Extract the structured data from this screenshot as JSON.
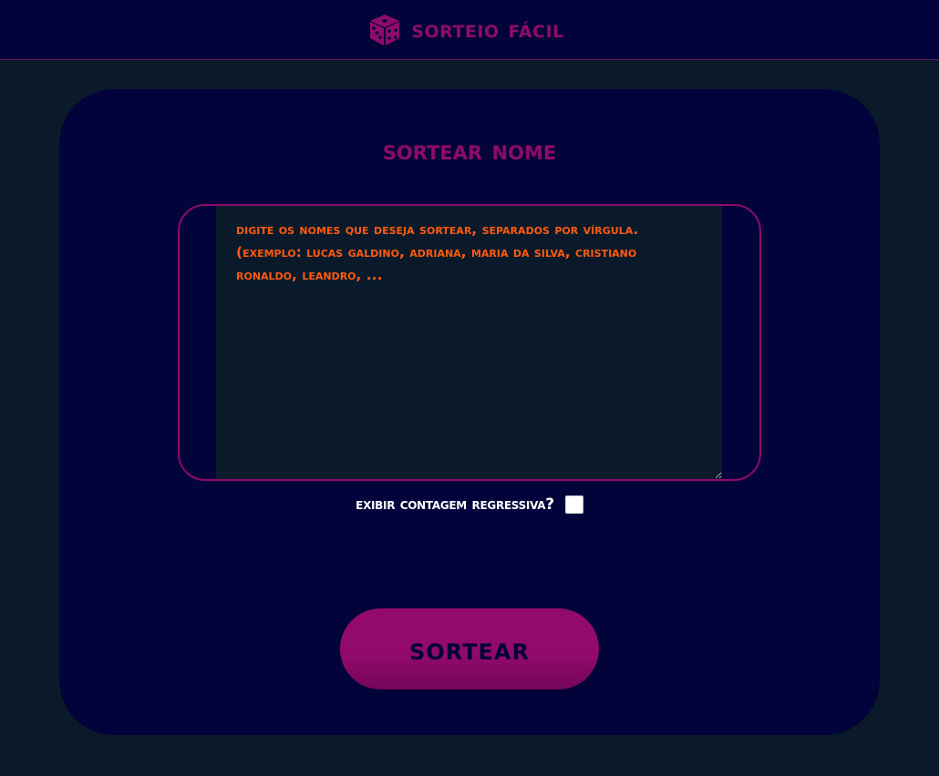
{
  "header": {
    "logo_icon": "dice-icon",
    "title": "Sorteio Fácil"
  },
  "main": {
    "title": "Sortear nome",
    "names_input": {
      "value": "",
      "placeholder": "Digite os nomes que deseja sortear, separados por vírgula. (Exemplo: Lucas Galdino, Adriana, Maria da Silva, Cristiano Ronaldo, Leandro, ..."
    },
    "countdown": {
      "label": "Exibir contagem regressiva?",
      "checked": false
    },
    "draw_button_label": "Sortear"
  },
  "colors": {
    "page_background": "#0a1a2a",
    "panel_background": "#02033a",
    "accent_magenta": "#8e0b6a",
    "placeholder_orange": "#ff5a10",
    "label_white": "#ffffff"
  }
}
